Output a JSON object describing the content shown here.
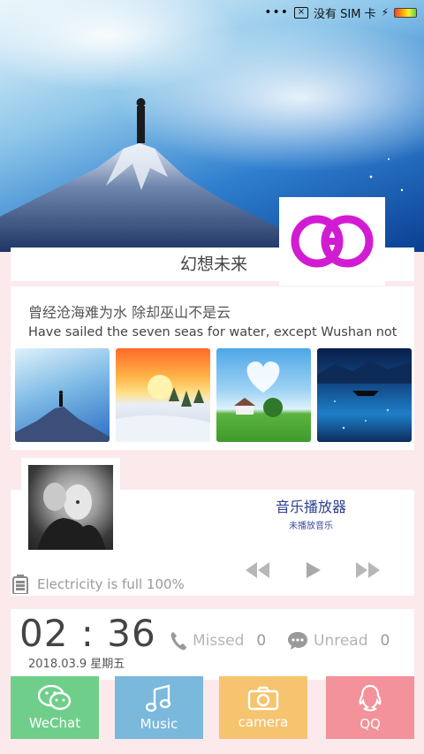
{
  "status": {
    "carrier": "没有 SIM 卡",
    "colors": {
      "battery_gradient": [
        "#ff3b30",
        "#ffb400",
        "#ffee33",
        "#57d24a"
      ]
    }
  },
  "header": {
    "title": "幻想未来"
  },
  "poem": {
    "chinese": "曾经沧海难为水  除却巫山不是云",
    "english": "Have sailed the seven seas for water, except Wushan not"
  },
  "gallery": {
    "images": [
      "mountain-peak-icon",
      "sunset-snow-icon",
      "heart-cloud-house-icon",
      "night-boat-icon"
    ]
  },
  "music": {
    "title": "音乐播放器",
    "status": "未播放音乐",
    "battery_text": "Electricity is full  100%",
    "accent": "#2c3f8f"
  },
  "clock": {
    "time": "02 : 36",
    "date": "2018.03.9  星期五",
    "missed_label": "Missed",
    "missed_count": "0",
    "unread_label": "Unread",
    "unread_count": "0"
  },
  "dock": {
    "wechat": "WeChat",
    "music": "Music",
    "camera": "camera",
    "qq": "QQ",
    "colors": {
      "wechat": "#6fcf8a",
      "music": "#7ab8dc",
      "camera": "#f6c46f",
      "qq": "#f3929a"
    }
  }
}
